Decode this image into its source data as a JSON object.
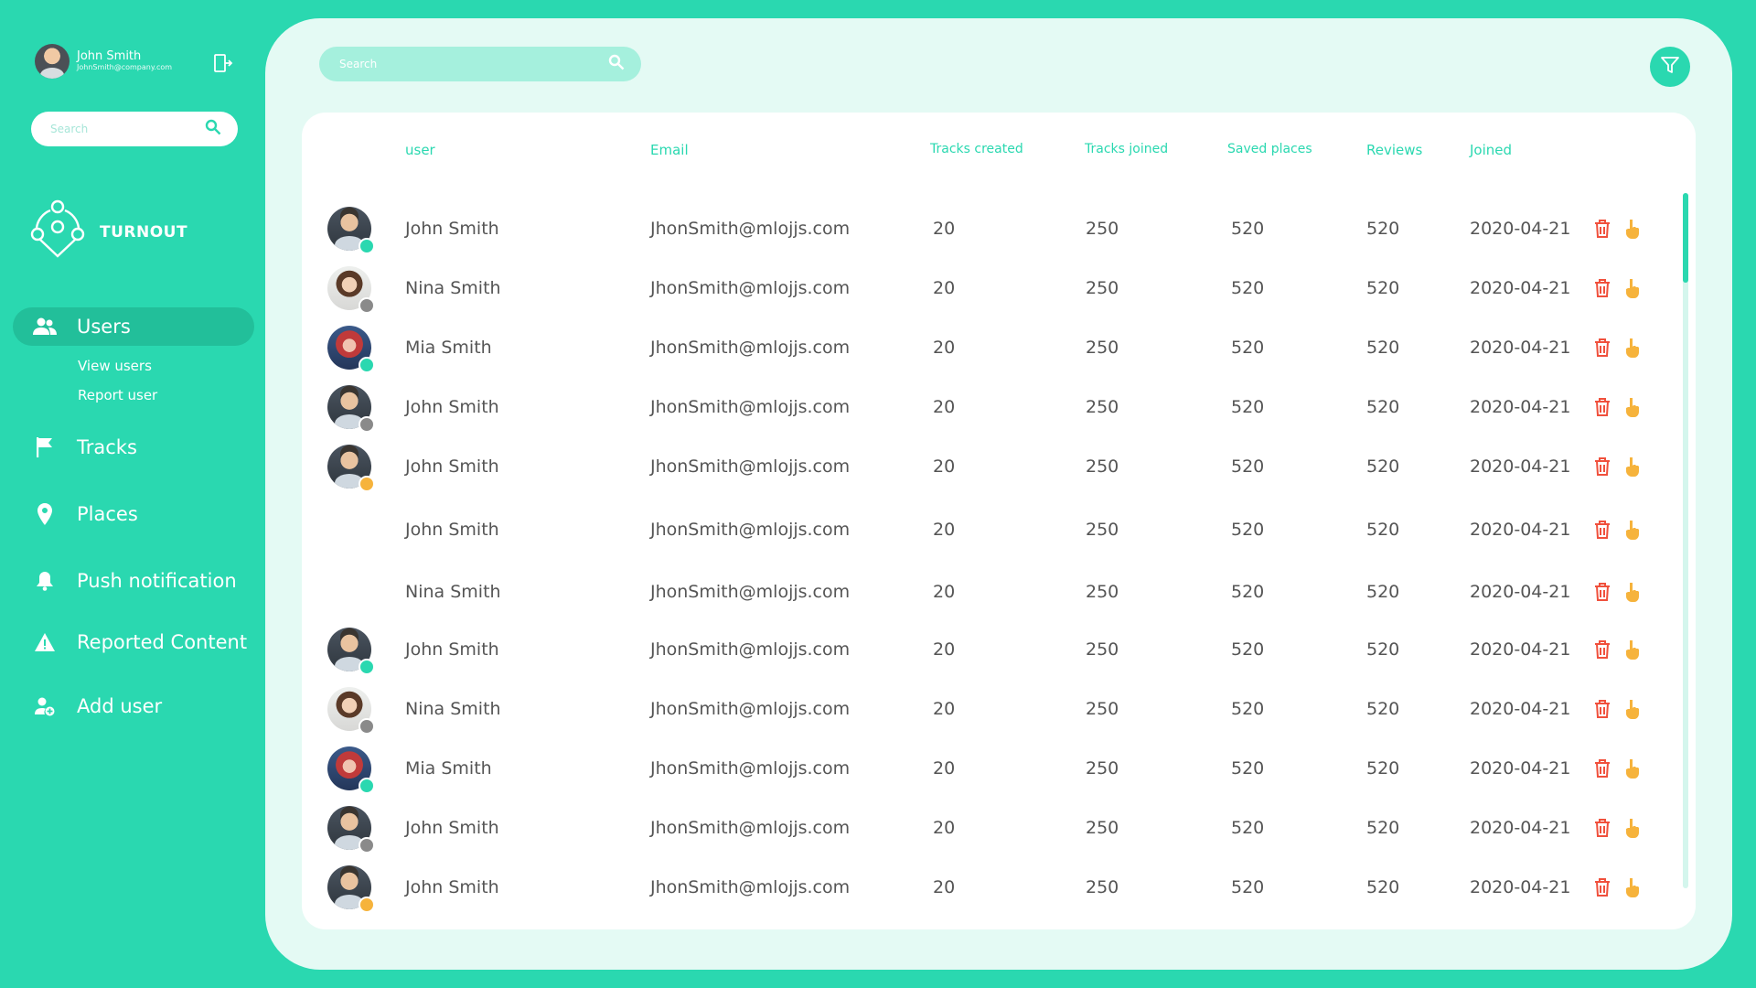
{
  "profile": {
    "name": "John Smith",
    "email": "JohnSmith@company.com"
  },
  "sidebar_search": {
    "placeholder": "Search"
  },
  "brand": {
    "name": "TURNOUT"
  },
  "nav": {
    "users": "Users",
    "view_users": "View users",
    "report_user": "Report user",
    "tracks": "Tracks",
    "places": "Places",
    "push": "Push notification",
    "reported": "Reported Content",
    "add_user": "Add user"
  },
  "main_search": {
    "placeholder": "Search"
  },
  "table": {
    "columns": [
      "user",
      "Email",
      "Tracks created",
      "Tracks joined",
      "Saved places",
      "Reviews",
      "Joined"
    ],
    "rows": [
      {
        "name": "John Smith",
        "email": "JhonSmith@mlojjs.com",
        "tracks_created": "20",
        "tracks_joined": "250",
        "saved_places": "520",
        "reviews": "520",
        "joined": "2020-04-21",
        "avatar": "john",
        "status": "green"
      },
      {
        "name": "Nina Smith",
        "email": "JhonSmith@mlojjs.com",
        "tracks_created": "20",
        "tracks_joined": "250",
        "saved_places": "520",
        "reviews": "520",
        "joined": "2020-04-21",
        "avatar": "nina",
        "status": "grey"
      },
      {
        "name": "Mia Smith",
        "email": "JhonSmith@mlojjs.com",
        "tracks_created": "20",
        "tracks_joined": "250",
        "saved_places": "520",
        "reviews": "520",
        "joined": "2020-04-21",
        "avatar": "mia",
        "status": "green"
      },
      {
        "name": "John Smith",
        "email": "JhonSmith@mlojjs.com",
        "tracks_created": "20",
        "tracks_joined": "250",
        "saved_places": "520",
        "reviews": "520",
        "joined": "2020-04-21",
        "avatar": "john",
        "status": "grey"
      },
      {
        "name": "John Smith",
        "email": "JhonSmith@mlojjs.com",
        "tracks_created": "20",
        "tracks_joined": "250",
        "saved_places": "520",
        "reviews": "520",
        "joined": "2020-04-21",
        "avatar": "john",
        "status": "orange"
      },
      {
        "name": "John Smith",
        "email": "JhonSmith@mlojjs.com",
        "tracks_created": "20",
        "tracks_joined": "250",
        "saved_places": "520",
        "reviews": "520",
        "joined": "2020-04-21",
        "avatar": "none",
        "status": "none"
      },
      {
        "name": "Nina Smith",
        "email": "JhonSmith@mlojjs.com",
        "tracks_created": "20",
        "tracks_joined": "250",
        "saved_places": "520",
        "reviews": "520",
        "joined": "2020-04-21",
        "avatar": "none",
        "status": "none"
      },
      {
        "name": "John Smith",
        "email": "JhonSmith@mlojjs.com",
        "tracks_created": "20",
        "tracks_joined": "250",
        "saved_places": "520",
        "reviews": "520",
        "joined": "2020-04-21",
        "avatar": "john",
        "status": "green"
      },
      {
        "name": "Nina Smith",
        "email": "JhonSmith@mlojjs.com",
        "tracks_created": "20",
        "tracks_joined": "250",
        "saved_places": "520",
        "reviews": "520",
        "joined": "2020-04-21",
        "avatar": "nina",
        "status": "grey"
      },
      {
        "name": "Mia Smith",
        "email": "JhonSmith@mlojjs.com",
        "tracks_created": "20",
        "tracks_joined": "250",
        "saved_places": "520",
        "reviews": "520",
        "joined": "2020-04-21",
        "avatar": "mia",
        "status": "green"
      },
      {
        "name": "John Smith",
        "email": "JhonSmith@mlojjs.com",
        "tracks_created": "20",
        "tracks_joined": "250",
        "saved_places": "520",
        "reviews": "520",
        "joined": "2020-04-21",
        "avatar": "john",
        "status": "grey"
      },
      {
        "name": "John Smith",
        "email": "JhonSmith@mlojjs.com",
        "tracks_created": "20",
        "tracks_joined": "250",
        "saved_places": "520",
        "reviews": "520",
        "joined": "2020-04-21",
        "avatar": "john",
        "status": "orange"
      }
    ]
  },
  "colors": {
    "brand": "#2ad8b0",
    "delete": "#f0503c",
    "hand": "#f6b33c"
  },
  "icons": {
    "delete": "trash-icon",
    "hand": "hand-pointer-icon",
    "filter": "filter-icon"
  }
}
